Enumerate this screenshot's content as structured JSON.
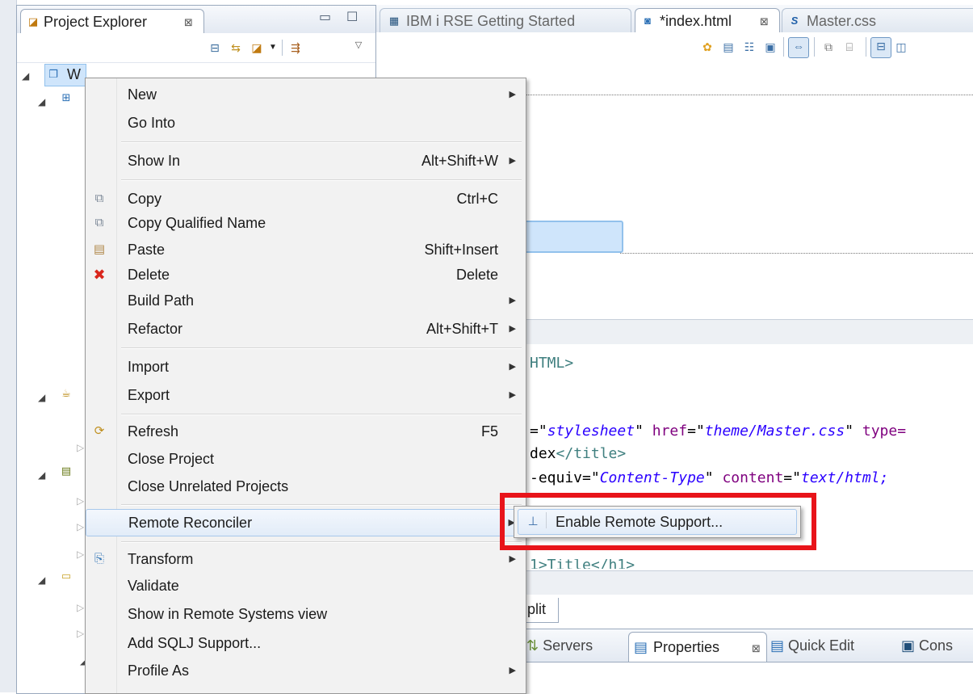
{
  "project_explorer": {
    "tab_label": "Project Explorer",
    "close_glyph": "⊠",
    "minimize_glyph": "▭",
    "maximize_glyph": "☐",
    "tree_root_label": "W",
    "toolbar_icons": [
      "collapse-all-icon",
      "link-with-editor-icon",
      "new-project-icon",
      "view-menu-dropdown-icon",
      "filter-icon",
      "view-menu-icon"
    ]
  },
  "editor": {
    "tabs": [
      {
        "label": "IBM i RSE Getting Started",
        "icon": "rse-page-icon",
        "active": false
      },
      {
        "label": "*index.html",
        "icon": "html-file-icon",
        "active": true
      },
      {
        "label": "Master.css",
        "icon": "css-file-icon",
        "active": false
      }
    ],
    "code_lines": [
      {
        "segments": [
          {
            "t": "tag",
            "v": "HTML>"
          }
        ]
      },
      {
        "segments": []
      },
      {
        "segments": [
          {
            "t": "txt",
            "v": "=\""
          },
          {
            "t": "val",
            "v": "stylesheet"
          },
          {
            "t": "txt",
            "v": "\" "
          },
          {
            "t": "attr",
            "v": "href"
          },
          {
            "t": "txt",
            "v": "=\""
          },
          {
            "t": "val",
            "v": "theme/Master.css"
          },
          {
            "t": "txt",
            "v": "\" "
          },
          {
            "t": "attr",
            "v": "type="
          }
        ]
      },
      {
        "segments": [
          {
            "t": "txt",
            "v": "dex"
          },
          {
            "t": "tag",
            "v": "</title>"
          }
        ]
      },
      {
        "segments": [
          {
            "t": "txt",
            "v": "-equiv=\""
          },
          {
            "t": "val",
            "v": "Content-Type"
          },
          {
            "t": "txt",
            "v": "\" "
          },
          {
            "t": "attr",
            "v": "content"
          },
          {
            "t": "txt",
            "v": "=\""
          },
          {
            "t": "val",
            "v": "text/html;"
          }
        ]
      }
    ],
    "partial_line": "1>Title</h1>",
    "bottom_tab_split": "plit"
  },
  "bottom_views": {
    "tabs": [
      {
        "label": "Servers",
        "icon": "servers-icon"
      },
      {
        "label": "Properties",
        "icon": "properties-icon",
        "active": true
      },
      {
        "label": "Quick Edit",
        "icon": "quick-edit-icon"
      },
      {
        "label": "Cons",
        "icon": "console-icon"
      }
    ]
  },
  "context_menu": {
    "items": [
      {
        "label": "New",
        "shortcut": "",
        "submenu": true,
        "icon": ""
      },
      {
        "label": "Go Into",
        "shortcut": "",
        "submenu": false,
        "icon": ""
      },
      {
        "label": "Show In",
        "shortcut": "Alt+Shift+W",
        "submenu": true,
        "icon": ""
      },
      {
        "label": "Copy",
        "shortcut": "Ctrl+C",
        "submenu": false,
        "icon": "copy-icon"
      },
      {
        "label": "Copy Qualified Name",
        "shortcut": "",
        "submenu": false,
        "icon": "copy-qualified-icon"
      },
      {
        "label": "Paste",
        "shortcut": "Shift+Insert",
        "submenu": false,
        "icon": "paste-icon"
      },
      {
        "label": "Delete",
        "shortcut": "Delete",
        "submenu": false,
        "icon": "delete-icon"
      },
      {
        "label": "Build Path",
        "shortcut": "",
        "submenu": true,
        "icon": ""
      },
      {
        "label": "Refactor",
        "shortcut": "Alt+Shift+T",
        "submenu": true,
        "icon": ""
      },
      {
        "label": "Import",
        "shortcut": "",
        "submenu": true,
        "icon": ""
      },
      {
        "label": "Export",
        "shortcut": "",
        "submenu": true,
        "icon": ""
      },
      {
        "label": "Refresh",
        "shortcut": "F5",
        "submenu": false,
        "icon": "refresh-icon"
      },
      {
        "label": "Close Project",
        "shortcut": "",
        "submenu": false,
        "icon": ""
      },
      {
        "label": "Close Unrelated Projects",
        "shortcut": "",
        "submenu": false,
        "icon": ""
      },
      {
        "label": "Remote Reconciler",
        "shortcut": "",
        "submenu": true,
        "icon": "",
        "highlighted": true
      },
      {
        "label": "Transform",
        "shortcut": "",
        "submenu": true,
        "icon": "transform-icon"
      },
      {
        "label": "Validate",
        "shortcut": "",
        "submenu": false,
        "icon": ""
      },
      {
        "label": "Show in Remote Systems view",
        "shortcut": "",
        "submenu": false,
        "icon": ""
      },
      {
        "label": "Add SQLJ Support...",
        "shortcut": "",
        "submenu": false,
        "icon": ""
      },
      {
        "label": "Profile As",
        "shortcut": "",
        "submenu": true,
        "icon": ""
      }
    ],
    "submenu": {
      "label": "Enable Remote Support...",
      "icon": "enable-remote-icon"
    }
  },
  "colors": {
    "highlight_box": "#e8141a",
    "selection_blue": "#cfe5fb",
    "menu_hover_border": "#a8c8eb"
  }
}
